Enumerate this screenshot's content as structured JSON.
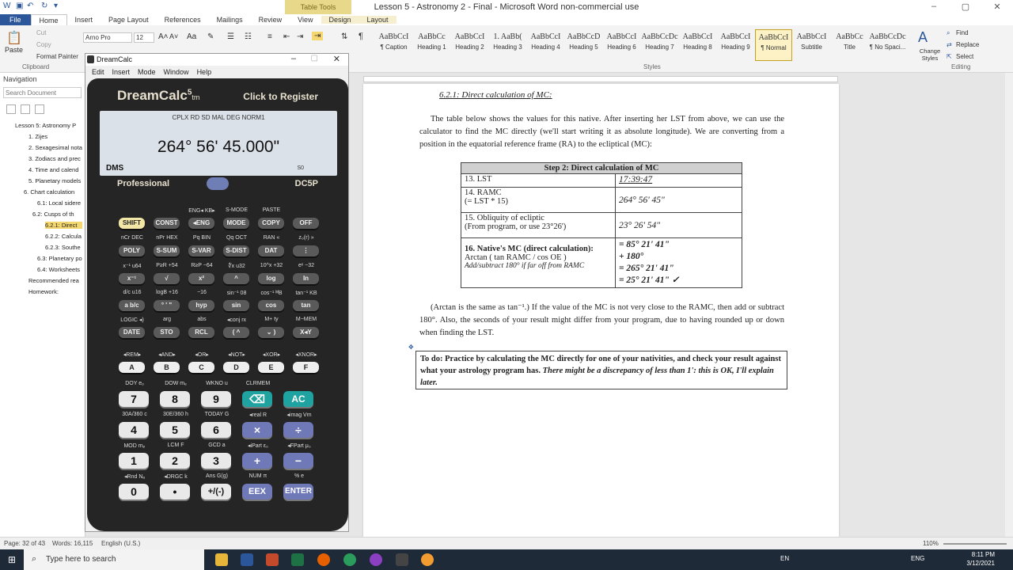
{
  "window": {
    "title": "Lesson 5 - Astronomy 2 - Final  -  Microsoft Word non-commercial use",
    "table_tools": "Table Tools"
  },
  "tabs": [
    "File",
    "Home",
    "Insert",
    "Page Layout",
    "References",
    "Mailings",
    "Review",
    "View",
    "Design",
    "Layout"
  ],
  "ribbon": {
    "clipboard": {
      "label": "Clipboard",
      "paste": "Paste",
      "cut": "Cut",
      "copy": "Copy",
      "format_painter": "Format Painter"
    },
    "font": {
      "name": "Arno Pro",
      "size": "12"
    },
    "styles_label": "Styles",
    "styles": [
      {
        "sample": "AaBbCcI",
        "name": "¶ Caption"
      },
      {
        "sample": "AaBbCc",
        "name": "Heading 1"
      },
      {
        "sample": "AaBbCcI",
        "name": "Heading 2"
      },
      {
        "sample": "1. AaBb(",
        "name": "Heading 3"
      },
      {
        "sample": "AaBbCcI",
        "name": "Heading 4"
      },
      {
        "sample": "AaBbCcD",
        "name": "Heading 5"
      },
      {
        "sample": "AaBbCcI",
        "name": "Heading 6"
      },
      {
        "sample": "AaBbCcDc",
        "name": "Heading 7"
      },
      {
        "sample": "AaBbCcI",
        "name": "Heading 8"
      },
      {
        "sample": "AaBbCcI",
        "name": "Heading 9"
      },
      {
        "sample": "AaBbCcI",
        "name": "¶ Normal"
      },
      {
        "sample": "AaBbCcI",
        "name": "Subtitle"
      },
      {
        "sample": "AaBbCc",
        "name": "Title"
      },
      {
        "sample": "AaBbCcDc",
        "name": "¶ No Spaci..."
      }
    ],
    "change_styles": "Change Styles",
    "editing": {
      "label": "Editing",
      "find": "Find",
      "replace": "Replace",
      "select": "Select"
    }
  },
  "navigation": {
    "title": "Navigation",
    "search_placeholder": "Search Document",
    "items": [
      "Lesson 5: Astronomy P",
      "1. Zijes",
      "2. Sexagesimal nota",
      "3. Zodiacs and prec",
      "4. Time and calend",
      "5. Planetary models",
      "6. Chart calculation",
      "6.1: Local sidere",
      "6.2: Cusps of th",
      "6.2.1: Direct",
      "6.2.2: Calcula",
      "6.2.3: Southe",
      "6.3: Planetary po",
      "6.4: Worksheets",
      "Recommended rea",
      "Homework:"
    ]
  },
  "document": {
    "heading": "6.2.1: Direct calculation of MC:",
    "para1": "The table below shows the values for this native. After inserting her LST from above, we can use the calculator to find the MC directly (we'll start writing it as absolute longitude). We are converting from a position in the equatorial reference frame (RA) to the ecliptical (MC):",
    "table": {
      "title": "Step 2: Direct calculation of MC",
      "row13_label": "13. LST",
      "row13_value": "17:39:47",
      "row14_label": "14. RAMC",
      "row14_sub": "(= LST * 15)",
      "row14_value": "264° 56' 45\"",
      "row15_label": "15. Obliquity of ecliptic",
      "row15_sub": "(From program, or use 23°26')",
      "row15_value": "23° 26' 54\"",
      "row16_label": "16. Native's MC (direct calculation):",
      "row16_sub": "Arctan ( tan RAMC / cos OE )",
      "row16_note": "Add/subtract 180° if far off from RAMC",
      "row16_v1": "= 85° 21' 41\"",
      "row16_v2": "+ 180°",
      "row16_v3": "= 265° 21' 41\"",
      "row16_v4": "= 25° 21' 41\" ✓"
    },
    "para2": "(Arctan is the same as tan⁻¹.) If the value of the MC is not very close to the RAMC, then add or subtract 180°. Also, the seconds of your result might differ from your program, due to having rounded up or down when finding the LST.",
    "todo_bold": "To do: Practice by calculating the MC directly for one of your nativities, and check your result against what your astrology program has.",
    "todo_italic": "There might be a discrepancy of less than 1': this is OK, I'll explain later."
  },
  "calc": {
    "window_title": "DreamCalc",
    "menu": [
      "Edit",
      "Insert",
      "Mode",
      "Window",
      "Help"
    ],
    "brand": "DreamCalc",
    "brand_sup": "5",
    "brand_tm": "tm",
    "register": "Click to Register",
    "lcd_modes": "CPLX RD SD MAL DEG NORM1",
    "lcd_value": "264° 56' 45.000\"",
    "lcd_format": "DMS",
    "lcd_memory": "S0",
    "edition": "Professional",
    "model": "DC5P",
    "row1": {
      "top": [
        "",
        "",
        "ENG◂ KB▸",
        "S-MODE",
        "PASTE",
        ""
      ],
      "keys": [
        "SHIFT",
        "CONST",
        "◂ENG",
        "MODE",
        "COPY",
        "OFF"
      ]
    },
    "row2": {
      "top": [
        "nCr DEC",
        "nPr HEX",
        "Pq  BIN",
        "Qq  OCT",
        "RAN  «",
        "z₀(r) »"
      ],
      "keys": [
        "POLY",
        "S-SUM",
        "S-VAR",
        "S-DIST",
        "DAT",
        "⋮"
      ]
    },
    "row3": {
      "top": [
        "x⁻¹  u64",
        "P≥R +54",
        "R≥P −64",
        "∜x  u32",
        "10^x +32",
        "eˣ  −32"
      ],
      "keys": [
        "x⁻¹",
        "√",
        "x²",
        "^",
        "log",
        "ln"
      ]
    },
    "row4": {
      "top": [
        "d/c  u16",
        "logB +16",
        "  −16",
        "sin⁻¹  08",
        "cos⁻¹ ᴹB",
        "tan⁻¹ KB"
      ],
      "keys": [
        "a b/c",
        "° ' \"",
        "hyp",
        "sin",
        "cos",
        "tan"
      ]
    },
    "row5": {
      "top": [
        "LOGIC ◂)",
        "arg",
        "abs",
        "◂conj  rx",
        "M+  ty",
        "M−MEM"
      ],
      "keys": [
        "DATE",
        "STO",
        "RCL",
        "( ^",
        "⌄ )",
        "X◂Y"
      ]
    },
    "row6": {
      "top": [
        "◂REM▸",
        "◂AND▸",
        "◂OR▸",
        "◂NOT▸",
        "◂XOR▸",
        "◂XNOR▸"
      ],
      "keys": [
        "A",
        "B",
        "C",
        "D",
        "E",
        "F"
      ]
    },
    "num_row1": {
      "top": [
        "DOY  eₒ",
        "DOW  mₑ",
        "WKNO  u",
        "CLRMEM",
        ""
      ],
      "keys": [
        "7",
        "8",
        "9",
        "⌫",
        "AC"
      ]
    },
    "num_row2": {
      "top": [
        "30A/360 c",
        "30E/360 h",
        "TODAY G",
        "◂real  R",
        "◂imag  Vm"
      ],
      "keys": [
        "4",
        "5",
        "6",
        "×",
        "÷"
      ]
    },
    "num_row3": {
      "top": [
        "MOD  mₚ",
        "LCM  F",
        "GCD  a",
        "◂iPart  ε₀",
        "◂FPart  μ₀"
      ],
      "keys": [
        "1",
        "2",
        "3",
        "+",
        "−"
      ]
    },
    "num_row4": {
      "top": [
        "◂Rnd  Nₐ",
        "◂DRGC  k",
        "Ans  G(g)",
        "NUM  π",
        "%  e"
      ],
      "keys": [
        "0",
        "•",
        "+/(-)",
        "EEX",
        "ENTER"
      ]
    }
  },
  "status": {
    "page": "Page: 32 of 43",
    "words": "Words: 16,115",
    "language": "English (U.S.)",
    "zoom": "110%"
  },
  "taskbar": {
    "search_placeholder": "Type here to search",
    "lang": "ENG",
    "input": "EN",
    "time": "8:11 PM",
    "date": "3/12/2021"
  }
}
